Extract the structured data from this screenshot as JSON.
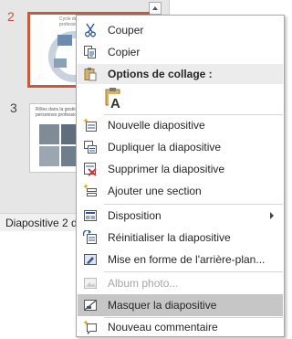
{
  "thumbnails": {
    "slides": [
      {
        "number": "2",
        "title_text": "Cycle de gestion des personnes professionnels"
      },
      {
        "number": "3",
        "title_text": "Rôles dans la gestion des personnes professionnels"
      }
    ],
    "status_label": "Diapositive 2 d"
  },
  "context_menu": {
    "cut": "Couper",
    "copy": "Copier",
    "paste_header": "Options de collage :",
    "new_slide": "Nouvelle diapositive",
    "duplicate": "Dupliquer la diapositive",
    "delete": "Supprimer la diapositive",
    "add_section": "Ajouter une section",
    "layout": "Disposition",
    "reset": "Réinitialiser la diapositive",
    "format_background": "Mise en forme de l'arrière-plan...",
    "photo_album": "Album photo...",
    "hide_slide": "Masquer la diapositive",
    "new_comment": "Nouveau commentaire"
  },
  "colors": {
    "accent": "#c55a3c",
    "hover": "#c6c6c6",
    "disabled_text": "#a6a6a6"
  }
}
